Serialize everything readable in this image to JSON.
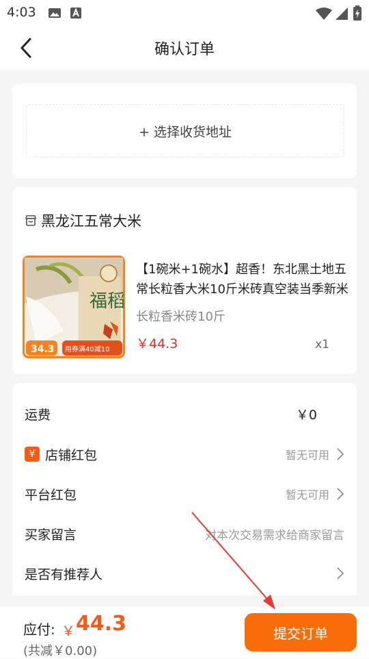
{
  "status": {
    "time": "4:03"
  },
  "nav": {
    "title": "确认订单"
  },
  "address": {
    "add_label": "+ 选择收货地址"
  },
  "shop": {
    "name": "黑龙江五常大米"
  },
  "product": {
    "title": "【1碗米+1碗水】超香！东北黑土地五常长粒香大米10斤米砖真空装当季新米",
    "spec": "长粒香米砖10斤",
    "price": "￥44.3",
    "qty": "x1",
    "img_tag": "用券满40减10",
    "img_price": "34.3",
    "img_label": "福稻"
  },
  "rows": {
    "shipping": {
      "label": "运费",
      "value": "￥0"
    },
    "shop_coupon": {
      "badge": "¥",
      "label": "店铺红包",
      "value": "暂无可用"
    },
    "platform_coupon": {
      "label": "平台红包",
      "value": "暂无可用"
    },
    "buyer_note": {
      "label": "买家留言",
      "placeholder": "对本次交易需求给商家留言"
    },
    "referrer": {
      "label": "是否有推荐人"
    }
  },
  "footer": {
    "total_label": "应付:",
    "currency": "￥",
    "amount": "44.3",
    "saved": "(共减￥0.00)",
    "submit_label": "提交订单"
  },
  "colors": {
    "accent": "#fa6e0a",
    "price_red": "#e02e24"
  }
}
